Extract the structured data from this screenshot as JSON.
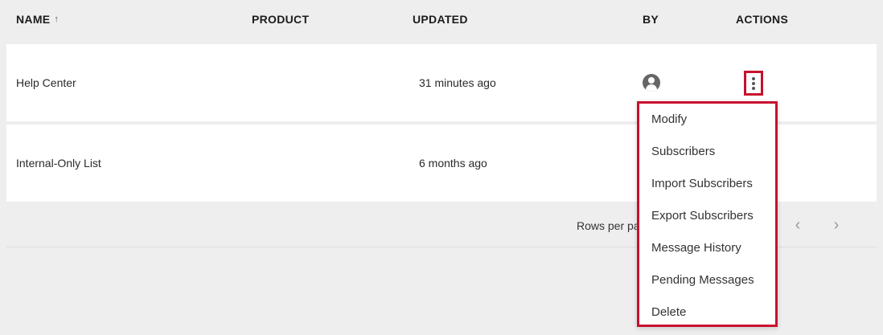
{
  "table": {
    "columns": {
      "name": "NAME",
      "name_sort_icon": "arrow-up-icon",
      "product": "PRODUCT",
      "updated": "UPDATED",
      "by": "BY",
      "actions": "ACTIONS"
    },
    "rows": [
      {
        "name": "Help Center",
        "product": "",
        "updated": "31 minutes ago",
        "by_icon": "user-avatar-icon",
        "actions_icon": "more-vert-icon"
      },
      {
        "name": "Internal-Only List",
        "product": "",
        "updated": "6 months ago"
      }
    ]
  },
  "pagination": {
    "rows_per_page_label": "Rows per pa",
    "prev_icon": "chevron-left-icon",
    "next_icon": "chevron-right-icon"
  },
  "actions_menu": {
    "items": [
      "Modify",
      "Subscribers",
      "Import Subscribers",
      "Export Subscribers",
      "Message History",
      "Pending Messages",
      "Delete"
    ]
  },
  "colors": {
    "background": "#eeeeee",
    "row_background": "#ffffff",
    "highlight_border": "#c8102e",
    "icon_gray": "#666666"
  }
}
